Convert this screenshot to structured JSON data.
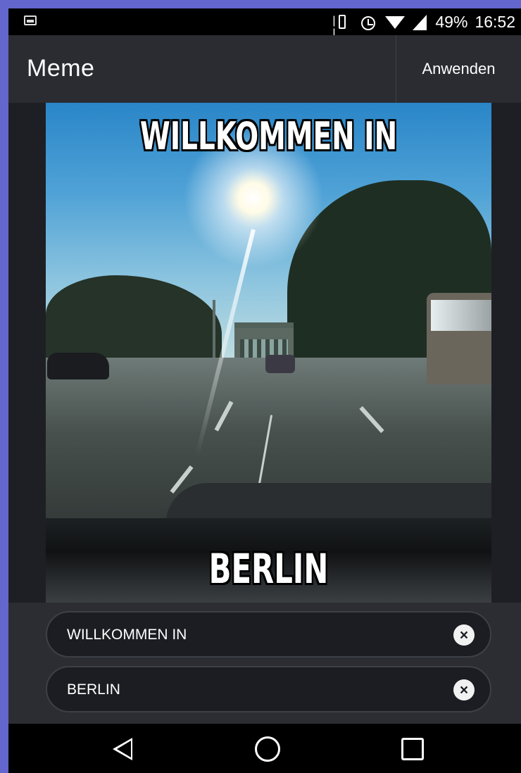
{
  "status_bar": {
    "battery": "49%",
    "time": "16:52",
    "icons": [
      "gallery-notification-icon",
      "vibrate-icon",
      "alarm-icon",
      "wifi-icon",
      "signal-icon"
    ]
  },
  "app_bar": {
    "title": "Meme",
    "apply_label": "Anwenden"
  },
  "meme": {
    "top_text": "WILLKOMMEN IN",
    "bottom_text": "BERLIN"
  },
  "fields": [
    {
      "value": "WILLKOMMEN IN",
      "clear_icon": "clear-icon"
    },
    {
      "value": "BERLIN",
      "clear_icon": "clear-icon"
    }
  ],
  "nav_bar": {
    "icons": [
      "back-icon",
      "home-icon",
      "recents-icon"
    ]
  },
  "colors": {
    "app_bar": "#2b2c31",
    "background": "#1b1c20",
    "field_background": "#1b1d22",
    "text": "#ffffff"
  }
}
